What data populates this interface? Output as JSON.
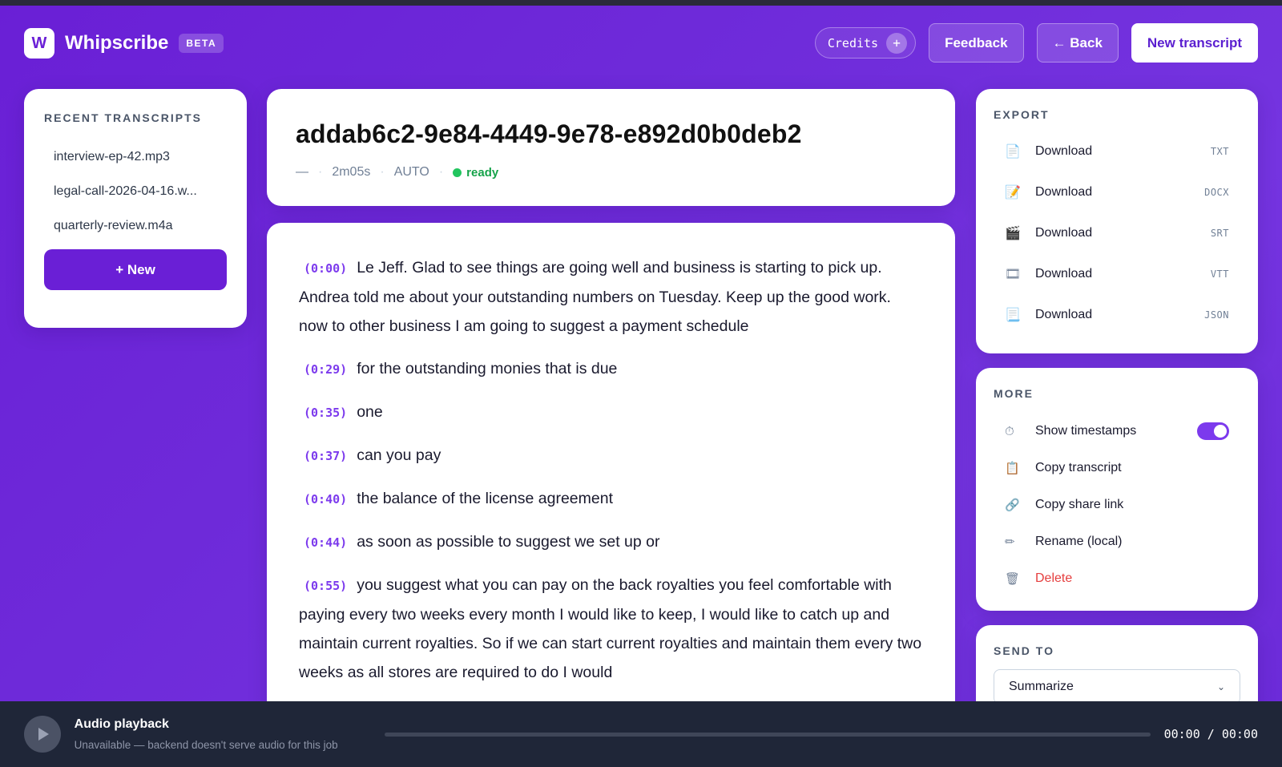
{
  "app": {
    "logo_letter": "W",
    "name": "Whipscribe",
    "badge": "BETA"
  },
  "header": {
    "credits_label": "Credits",
    "credits_plus": "+",
    "feedback_label": "Feedback",
    "back_label": "← Back",
    "new_transcript_label": "New transcript"
  },
  "sidebar": {
    "title": "RECENT TRANSCRIPTS",
    "items": [
      {
        "label": "interview-ep-42.mp3"
      },
      {
        "label": "legal-call-2026-04-16.w..."
      },
      {
        "label": "quarterly-review.m4a"
      }
    ],
    "new_button": "+ New"
  },
  "job": {
    "title": "addab6c2-9e84-4449-9e78-e892d0b0deb2",
    "meta_dash": "—",
    "duration": "2m05s",
    "language": "AUTO",
    "status": "ready"
  },
  "transcript": {
    "segments": [
      {
        "time": "(0:00)",
        "text": "Le Jeff. Glad to see things are going well and business is starting to pick up. Andrea told me about your outstanding numbers on Tuesday. Keep up the good work. now to other business I am going to suggest a payment schedule"
      },
      {
        "time": "(0:29)",
        "text": "for the outstanding monies that is due"
      },
      {
        "time": "(0:35)",
        "text": "one"
      },
      {
        "time": "(0:37)",
        "text": "can you pay"
      },
      {
        "time": "(0:40)",
        "text": "the balance of the license agreement"
      },
      {
        "time": "(0:44)",
        "text": "as soon as possible to suggest we set up or"
      },
      {
        "time": "(0:55)",
        "text": "you suggest what you can pay on the back royalties you feel comfortable with paying every two weeks every month I would like to keep, I would like to catch up and maintain current royalties. So if we can start current royalties and maintain them every two weeks as all stores are required to do I would"
      }
    ]
  },
  "export": {
    "title": "EXPORT",
    "items": [
      {
        "icon": "file-icon",
        "glyph": "📄",
        "label": "Download",
        "format": "TXT"
      },
      {
        "icon": "memo-icon",
        "glyph": "📝",
        "label": "Download",
        "format": "DOCX"
      },
      {
        "icon": "clapper-icon",
        "glyph": "🎬",
        "label": "Download",
        "format": "SRT"
      },
      {
        "icon": "film-icon",
        "glyph": "🎞",
        "label": "Download",
        "format": "VTT"
      },
      {
        "icon": "data-file-icon",
        "glyph": "📃",
        "label": "Download",
        "format": "JSON"
      }
    ]
  },
  "more": {
    "title": "MORE",
    "show_timestamps": {
      "glyph": "⏱",
      "label": "Show timestamps",
      "enabled": true
    },
    "items": [
      {
        "icon": "clipboard-icon",
        "glyph": "📋",
        "label": "Copy transcript"
      },
      {
        "icon": "link-icon",
        "glyph": "🔗",
        "label": "Copy share link"
      },
      {
        "icon": "pencil-icon",
        "glyph": "✏",
        "label": "Rename (local)"
      },
      {
        "icon": "trash-icon",
        "glyph": "🗑",
        "label": "Delete",
        "danger": true
      }
    ]
  },
  "send_to": {
    "title": "SEND TO",
    "selected": "Summarize"
  },
  "player": {
    "title": "Audio playback",
    "subtitle": "Unavailable — backend doesn't serve audio for this job",
    "time": "00:00 / 00:00",
    "progress": 0
  },
  "colors": {
    "accent": "#6a1fd6",
    "timestamp": "#7c3aed",
    "status_ready": "#16a34a",
    "danger": "#e53e3e"
  }
}
